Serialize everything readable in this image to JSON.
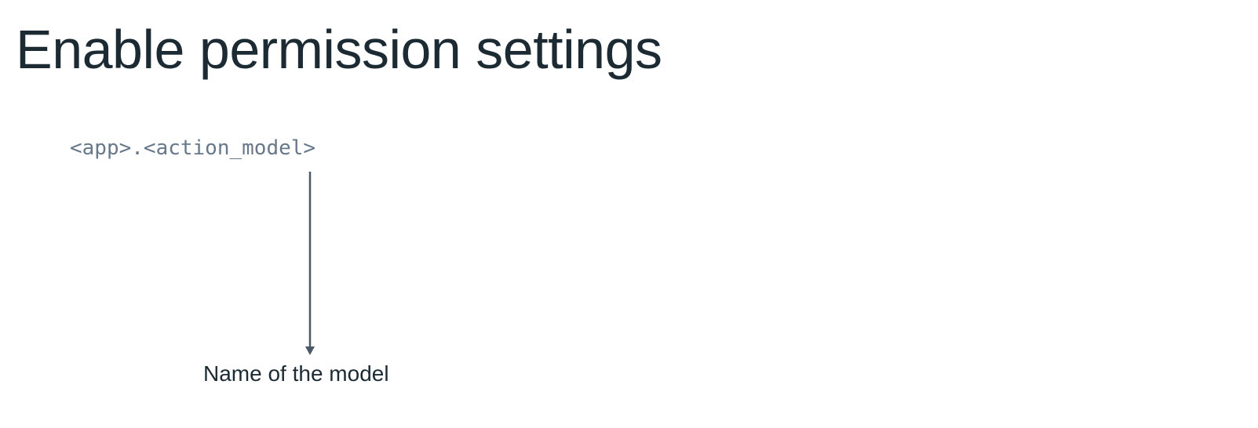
{
  "slide": {
    "title": "Enable permission settings",
    "code_text": "<app>.<action_model>",
    "caption": "Name of the model"
  },
  "colors": {
    "title": "#1c2b33",
    "code": "#67788a",
    "arrow": "#4b5866",
    "background": "#ffffff"
  }
}
